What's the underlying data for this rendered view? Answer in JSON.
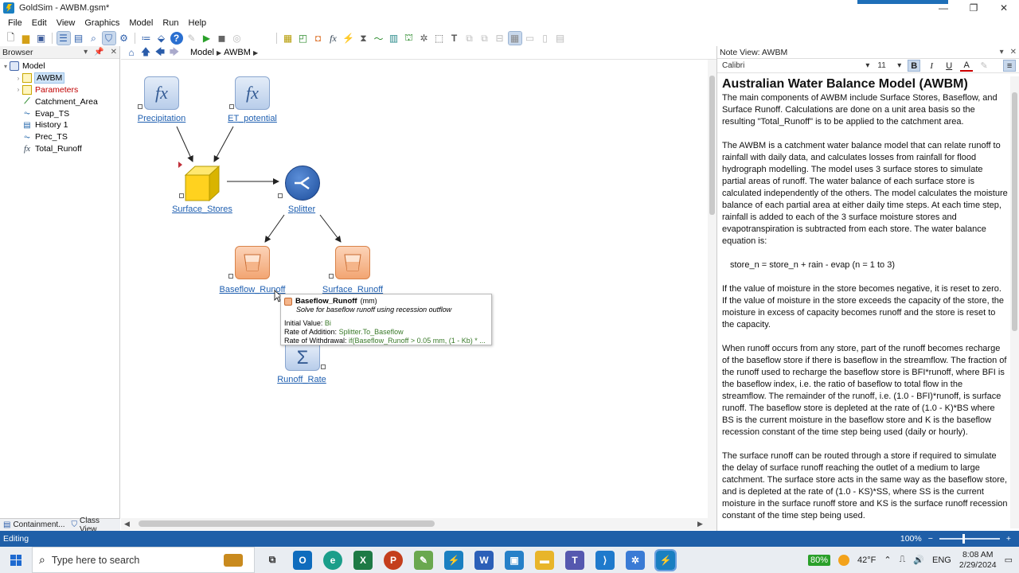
{
  "window": {
    "title": "GoldSim  - AWBM.gsm*",
    "minimize": "—",
    "maximize": "❐",
    "close": "✕"
  },
  "menu": [
    "File",
    "Edit",
    "View",
    "Graphics",
    "Model",
    "Run",
    "Help"
  ],
  "browser": {
    "title": "Browser",
    "tree": [
      {
        "label": "Model",
        "icon": "model-icon",
        "level": 0,
        "expanded": true
      },
      {
        "label": "AWBM",
        "icon": "container-icon",
        "level": 1,
        "selected": true
      },
      {
        "label": "Parameters",
        "icon": "container-icon",
        "level": 1,
        "red": true
      },
      {
        "label": "Catchment_Area",
        "icon": "data-icon",
        "level": 1
      },
      {
        "label": "Evap_TS",
        "icon": "time-series-icon",
        "level": 1
      },
      {
        "label": "History 1",
        "icon": "history-icon",
        "level": 1
      },
      {
        "label": "Prec_TS",
        "icon": "time-series-icon",
        "level": 1
      },
      {
        "label": "Total_Runoff",
        "icon": "expression-icon",
        "level": 1
      }
    ],
    "tabs": [
      "Containment...",
      "Class View"
    ]
  },
  "breadcrumb": [
    "Model",
    "AWBM"
  ],
  "elements": {
    "precipitation": "Precipitation",
    "et_potential": "ET_potential",
    "surface_stores": "Surface_Stores",
    "splitter": "Splitter",
    "baseflow_runoff": "Baseflow_Runoff",
    "surface_runoff": "Surface_Runoff",
    "runoff_rate": "Runoff_Rate"
  },
  "tooltip": {
    "title": "Baseflow_Runoff",
    "unit": "(mm)",
    "description": "Solve for baseflow runoff using recession outflow",
    "initial_label": "Initial Value:",
    "initial_value": "Bi",
    "addition_label": "Rate of Addition:",
    "addition_value": "Splitter.To_Baseflow",
    "withdrawal_label": "Rate of Withdrawal:",
    "withdrawal_value": "if(Baseflow_Runoff > 0.05 mm, (1 - Kb) * ..."
  },
  "note_view": {
    "title": "Note View: AWBM",
    "font": "Calibri",
    "size": "11",
    "heading": "Australian Water Balance Model (AWBM)",
    "paragraphs": [
      "The main components of AWBM include Surface Stores, Baseflow, and Surface Runoff. Calculations are done on a unit area basis so the resulting \"Total_Runoff\" is to be applied to the catchment area.",
      "The AWBM is a catchment water balance model that can relate runoff to rainfall with daily data, and calculates losses from rainfall for flood hydrograph modelling. The model uses 3 surface stores to simulate partial areas of runoff. The water balance of each surface store is calculated independently of the others. The model calculates the moisture balance of each partial area at either daily time steps. At each time step, rainfall is added to each of the 3 surface moisture stores and evapotranspiration is subtracted from each store. The water balance equation is:",
      "store_n = store_n + rain - evap (n = 1 to 3)",
      "If the value of moisture in the store becomes negative, it is reset to zero. If the value of moisture in the store exceeds the capacity of the store, the moisture in excess of capacity becomes runoff and the store is reset to the capacity.",
      "When runoff occurs from any store, part of the runoff becomes recharge of the baseflow store if there is baseflow in the streamflow. The fraction of the runoff used to recharge the baseflow store is BFI*runoff, where BFI is the baseflow index, i.e. the ratio of baseflow to total flow in the streamflow. The remainder of the runoff, i.e. (1.0 - BFI)*runoff, is surface runoff. The baseflow store is depleted at the rate of (1.0 - K)*BS where BS is the current moisture in the baseflow store and K is the baseflow recession constant of the time step being used (daily or hourly).",
      "The surface runoff can be routed through a store if required to simulate the delay of surface runoff reaching the outlet of a medium to large catchment. The surface store acts in the same way as the baseflow store, and is depleted at the rate of (1.0 - KS)*SS, where SS is the current moisture in the surface runoff store and KS is the surface runoff recession constant of the time step being used."
    ]
  },
  "status": {
    "mode": "Editing",
    "zoom": "100%",
    "zoom_level": 0.4
  },
  "taskbar": {
    "search_placeholder": "Type here to search",
    "battery": "80%",
    "weather": "42°F",
    "language": "ENG",
    "time": "8:08 AM",
    "date": "2/29/2024"
  }
}
